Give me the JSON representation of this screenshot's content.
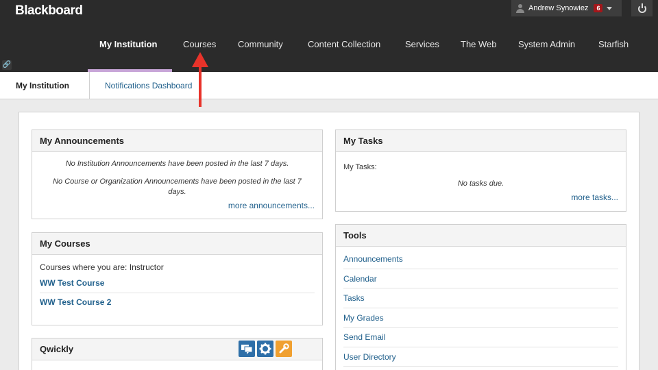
{
  "header": {
    "logo": "Blackboard",
    "user_name": "Andrew Synowiez",
    "notification_count": "6"
  },
  "nav": {
    "items": [
      {
        "label": "My Institution",
        "active": true
      },
      {
        "label": "Courses"
      },
      {
        "label": "Community"
      },
      {
        "label": "Content Collection"
      },
      {
        "label": "Services"
      },
      {
        "label": "The Web"
      },
      {
        "label": "System Admin"
      },
      {
        "label": "Starfish"
      }
    ]
  },
  "tabs": {
    "active": "My Institution",
    "link": "Notifications Dashboard"
  },
  "announcements": {
    "title": "My Announcements",
    "line1": "No Institution Announcements have been posted in the last 7 days.",
    "line2": "No Course or Organization Announcements have been posted in the last 7 days.",
    "more": "more announcements..."
  },
  "courses": {
    "title": "My Courses",
    "role_line": "Courses where you are: Instructor",
    "items": [
      "WW Test Course",
      "WW Test Course 2"
    ]
  },
  "qwickly": {
    "title": "Qwickly"
  },
  "tasks": {
    "title": "My Tasks",
    "label": "My Tasks:",
    "empty": "No tasks due.",
    "more": "more tasks..."
  },
  "tools": {
    "title": "Tools",
    "items": [
      "Announcements",
      "Calendar",
      "Tasks",
      "My Grades",
      "Send Email",
      "User Directory"
    ]
  },
  "colors": {
    "header_bg": "#2b2b2b",
    "link": "#1f5f8b",
    "annotation_arrow": "#e8332a",
    "badge": "#a4161a"
  }
}
